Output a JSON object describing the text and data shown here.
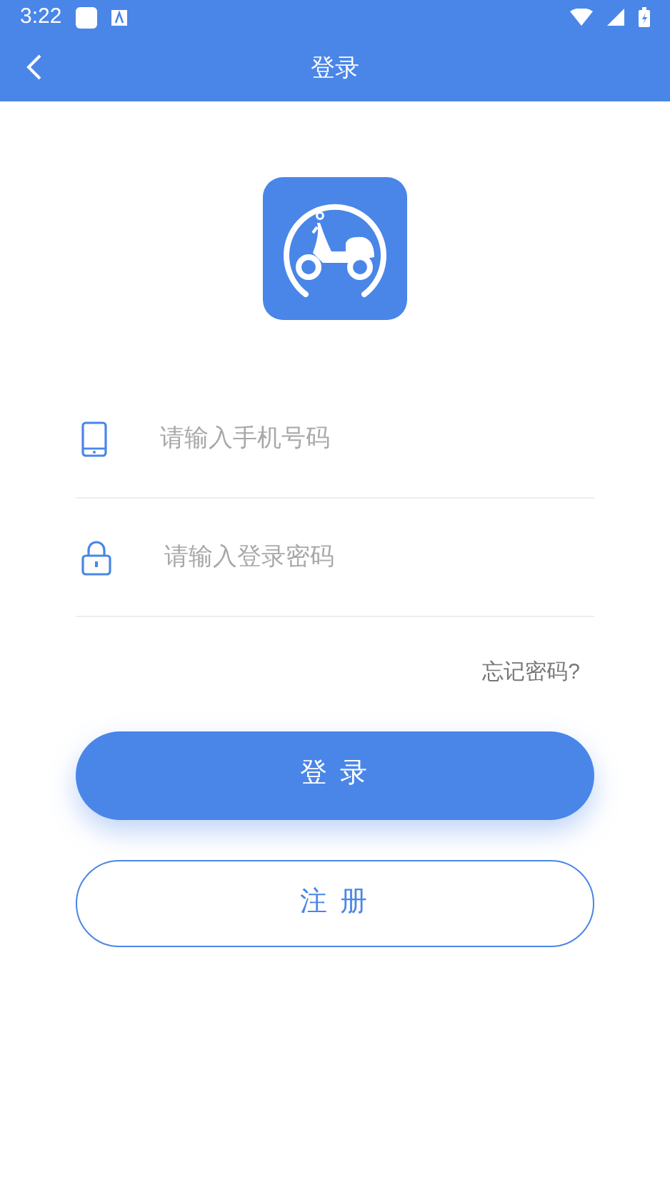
{
  "status_bar": {
    "time": "3:22"
  },
  "header": {
    "title": "登录"
  },
  "fields": [
    {
      "kind": "phone",
      "placeholder": "请输入手机号码"
    },
    {
      "kind": "password",
      "placeholder": "请输入登录密码"
    }
  ],
  "forgot_link": "忘记密码?",
  "buttons": [
    {
      "kind": "primary",
      "label": "登 录"
    },
    {
      "kind": "outline",
      "label": "注 册"
    }
  ]
}
